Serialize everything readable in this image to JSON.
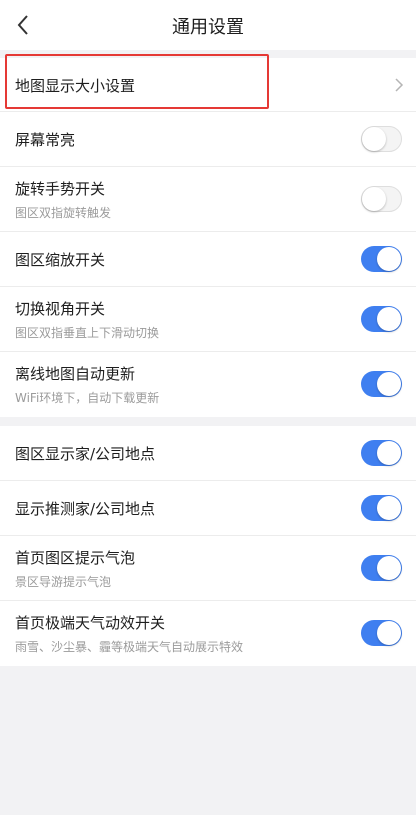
{
  "nav": {
    "title": "通用设置",
    "back_icon": "chevron-left-icon"
  },
  "highlight_color": "#e53935",
  "accent_color": "#3f7ff0",
  "settings": [
    {
      "label": "地图显示大小设置",
      "type": "link"
    },
    {
      "label": "屏幕常亮",
      "type": "toggle",
      "on": false
    },
    {
      "label": "旋转手势开关",
      "sub": "图区双指旋转触发",
      "type": "toggle",
      "on": false
    },
    {
      "label": "图区缩放开关",
      "type": "toggle",
      "on": true
    },
    {
      "label": "切换视角开关",
      "sub": "图区双指垂直上下滑动切换",
      "type": "toggle",
      "on": true
    },
    {
      "label": "离线地图自动更新",
      "sub": "WiFi环境下，自动下载更新",
      "type": "toggle",
      "on": true
    },
    {
      "label": "图区显示家/公司地点",
      "type": "toggle",
      "on": true
    },
    {
      "label": "显示推测家/公司地点",
      "type": "toggle",
      "on": true
    },
    {
      "label": "首页图区提示气泡",
      "sub": "景区导游提示气泡",
      "type": "toggle",
      "on": true
    },
    {
      "label": "首页极端天气动效开关",
      "sub": "雨雪、沙尘暴、霾等极端天气自动展示特效",
      "type": "toggle",
      "on": true
    }
  ]
}
